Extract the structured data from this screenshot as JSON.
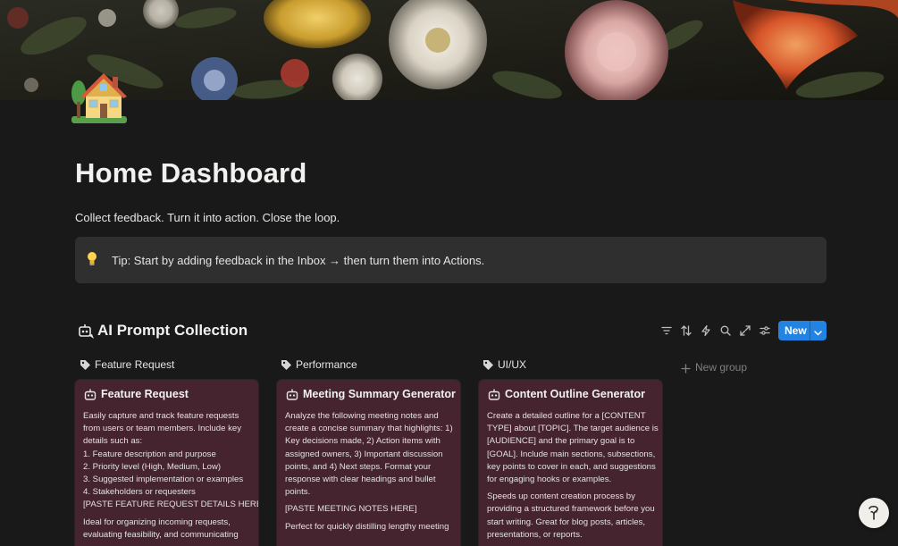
{
  "page": {
    "title": "Home Dashboard",
    "subtitle": "Collect feedback. Turn it into action. Close the loop.",
    "icon": "house-icon"
  },
  "callout": {
    "icon": "light-bulb-icon",
    "text": "Tip: Start by adding feedback in the Inbox → then turn them into Actions."
  },
  "database": {
    "title": "AI Prompt Collection",
    "icon": "robot-prompt-icon",
    "toolbar": {
      "icons": [
        "filter-icon",
        "sort-icon",
        "automation-icon",
        "search-icon",
        "expand-icon",
        "settings-icon"
      ],
      "new_label": "New"
    },
    "groups": [
      {
        "name": "Feature Request",
        "card": {
          "title": "Feature Request",
          "lines": [
            "Easily capture and track feature requests",
            "from users or team members. Include key",
            "details such as:",
            "1. Feature description and purpose",
            "2. Priority level (High, Medium, Low)",
            "3. Suggested implementation or examples",
            "4. Stakeholders or requesters",
            "[PASTE FEATURE REQUEST DETAILS HERE]"
          ],
          "lines2": [
            "Ideal for organizing incoming requests,",
            "evaluating feasibility, and communicating"
          ]
        }
      },
      {
        "name": "Performance",
        "card": {
          "title": "Meeting Summary Generator",
          "lines": [
            "Analyze the following meeting notes and",
            "create a concise summary that highlights: 1)",
            "Key decisions made, 2) Action items with",
            "assigned owners, 3) Important discussion",
            "points, and 4) Next steps. Format your",
            "response with clear headings and bullet",
            "points."
          ],
          "lines2": [
            "[PASTE MEETING NOTES HERE]"
          ],
          "lines3": [
            "Perfect for quickly distilling lengthy meeting"
          ]
        }
      },
      {
        "name": "UI/UX",
        "card": {
          "title": "Content Outline Generator",
          "lines": [
            "Create a detailed outline for a [CONTENT",
            "TYPE] about [TOPIC]. The target audience is",
            "[AUDIENCE] and the primary goal is to",
            "[GOAL]. Include main sections, subsections,",
            "key points to cover in each, and suggestions",
            "for engaging hooks or examples."
          ],
          "lines2": [
            "Speeds up content creation process by",
            "providing a structured framework before you",
            "start writing. Great for blog posts, articles,",
            "presentations, or reports."
          ]
        }
      }
    ],
    "new_group_label": "New group"
  },
  "colors": {
    "background": "#191919",
    "callout_bg": "#2f2f2f",
    "card_bg": "#45242f",
    "accent": "#2383e2"
  },
  "help_icon": "help-icon"
}
